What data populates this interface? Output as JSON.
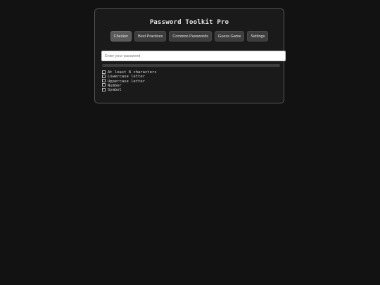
{
  "app": {
    "title": "Password Toolkit Pro"
  },
  "tabs": [
    {
      "label": "Checker",
      "active": true
    },
    {
      "label": "Best Practices",
      "active": false
    },
    {
      "label": "Common Passwords",
      "active": false
    },
    {
      "label": "Guess Game",
      "active": false
    },
    {
      "label": "Settings",
      "active": false
    }
  ],
  "password_input": {
    "value": "",
    "placeholder": "Enter your password"
  },
  "strength": {
    "fraction": 0
  },
  "requirements": [
    {
      "label": "At least 8 characters",
      "met": false,
      "icon": "checkbox-icon"
    },
    {
      "label": "Lowercase letter",
      "met": false,
      "icon": "checkbox-icon"
    },
    {
      "label": "Uppercase letter",
      "met": false,
      "icon": "checkbox-icon"
    },
    {
      "label": "Number",
      "met": false,
      "icon": "checkbox-icon"
    },
    {
      "label": "Symbol",
      "met": false,
      "icon": "checkbox-icon"
    }
  ],
  "colors": {
    "background": "#121212",
    "panel": "#1a1a1a",
    "tab_active": "#5a5a5a",
    "tab": "#3d3d3d"
  }
}
